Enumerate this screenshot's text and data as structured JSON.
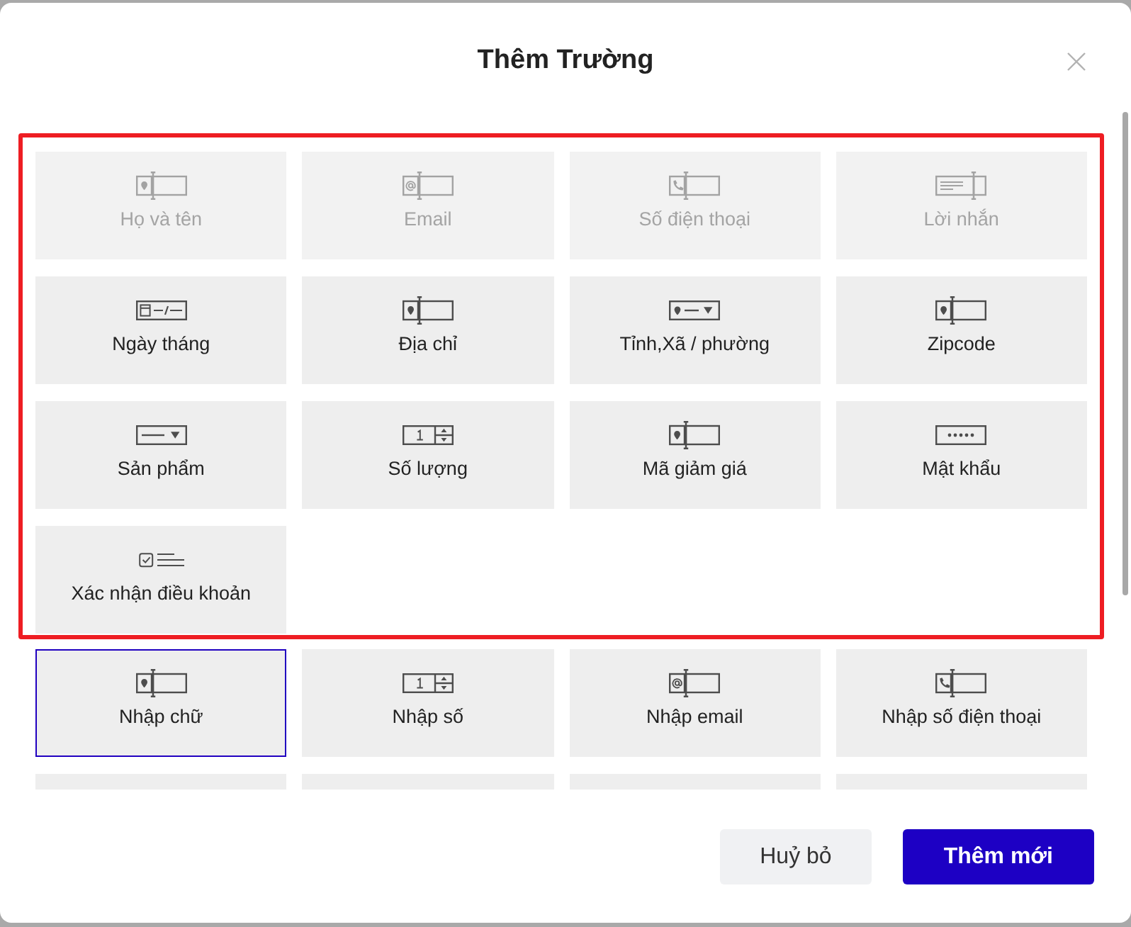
{
  "dialog": {
    "title": "Thêm Trường"
  },
  "groups": [
    {
      "highlighted": true,
      "fields": [
        {
          "label": "Họ và tên",
          "kind": "text",
          "disabled": true,
          "selected": false
        },
        {
          "label": "Email",
          "kind": "email",
          "disabled": true,
          "selected": false
        },
        {
          "label": "Số điện thoại",
          "kind": "phone",
          "disabled": true,
          "selected": false
        },
        {
          "label": "Lời nhắn",
          "kind": "message",
          "disabled": true,
          "selected": false
        },
        {
          "label": "Ngày tháng",
          "kind": "date",
          "disabled": false,
          "selected": false
        },
        {
          "label": "Địa chỉ",
          "kind": "text",
          "disabled": false,
          "selected": false
        },
        {
          "label": "Tỉnh,Xã / phường",
          "kind": "region",
          "disabled": false,
          "selected": false
        },
        {
          "label": "Zipcode",
          "kind": "text",
          "disabled": false,
          "selected": false
        },
        {
          "label": "Sản phẩm",
          "kind": "select",
          "disabled": false,
          "selected": false
        },
        {
          "label": "Số lượng",
          "kind": "number",
          "disabled": false,
          "selected": false
        },
        {
          "label": "Mã giảm giá",
          "kind": "text",
          "disabled": false,
          "selected": false
        },
        {
          "label": "Mật khẩu",
          "kind": "password",
          "disabled": false,
          "selected": false
        },
        {
          "label": "Xác nhận điều khoản",
          "kind": "consent",
          "disabled": false,
          "selected": false
        }
      ]
    },
    {
      "fields": [
        {
          "label": "Nhập chữ",
          "kind": "text",
          "disabled": false,
          "selected": true
        },
        {
          "label": "Nhập số",
          "kind": "number",
          "disabled": false,
          "selected": false
        },
        {
          "label": "Nhập email",
          "kind": "email",
          "disabled": false,
          "selected": false
        },
        {
          "label": "Nhập số điện thoại",
          "kind": "phone",
          "disabled": false,
          "selected": false
        },
        {
          "kind": "cut_off",
          "selected": false
        },
        {
          "kind": "cut_off",
          "selected": false
        },
        {
          "kind": "cut_off",
          "selected": false
        },
        {
          "kind": "cut_off",
          "selected": false
        }
      ]
    }
  ],
  "buttons": [
    {
      "label": "Huỷ bỏ",
      "kind": "secondary"
    },
    {
      "label": "Thêm mới",
      "kind": "primary"
    }
  ]
}
